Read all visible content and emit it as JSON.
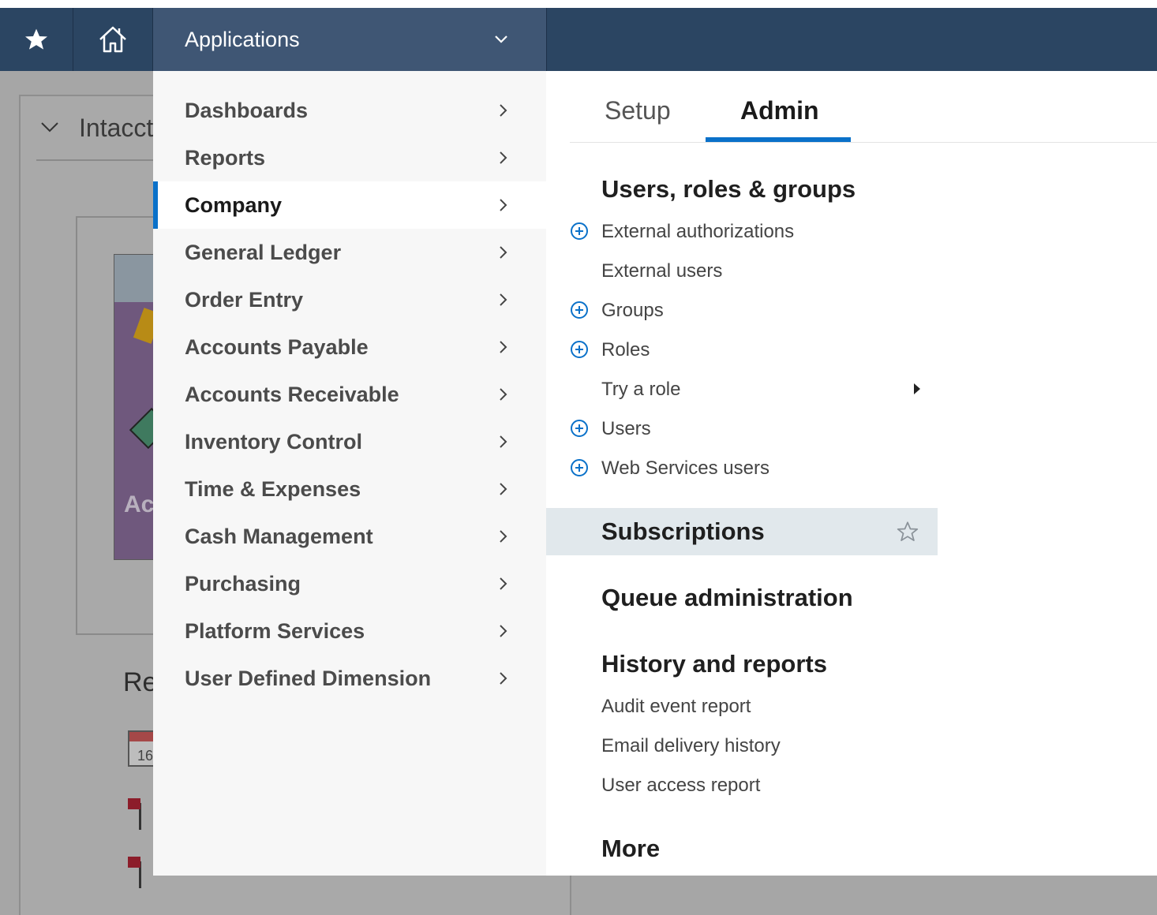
{
  "navbar": {
    "favorites_icon": "star-icon",
    "home_icon": "home-icon",
    "applications_label": "Applications"
  },
  "background_page": {
    "section_title": "Intacct",
    "tile_text": "Ac",
    "heading_partial": "Re",
    "calendar_day": "16"
  },
  "menu": {
    "items": [
      {
        "label": "Dashboards"
      },
      {
        "label": "Reports"
      },
      {
        "label": "Company"
      },
      {
        "label": "General Ledger"
      },
      {
        "label": "Order Entry"
      },
      {
        "label": "Accounts Payable"
      },
      {
        "label": "Accounts Receivable"
      },
      {
        "label": "Inventory Control"
      },
      {
        "label": "Time & Expenses"
      },
      {
        "label": "Cash Management"
      },
      {
        "label": "Purchasing"
      },
      {
        "label": "Platform Services"
      },
      {
        "label": "User Defined Dimension"
      }
    ],
    "active_item": "Company"
  },
  "submenu": {
    "tabs": [
      {
        "label": "Setup"
      },
      {
        "label": "Admin"
      }
    ],
    "active_tab": "Admin",
    "users_section": {
      "heading": "Users, roles & groups",
      "links": [
        {
          "label": "External authorizations",
          "add": true
        },
        {
          "label": "External users",
          "add": false
        },
        {
          "label": "Groups",
          "add": true
        },
        {
          "label": "Roles",
          "add": true
        },
        {
          "label": "Try a role",
          "add": false
        },
        {
          "label": "Users",
          "add": true
        },
        {
          "label": "Web Services users",
          "add": true
        }
      ]
    },
    "subscriptions": "Subscriptions",
    "queue_administration": "Queue administration",
    "history_section": {
      "heading": "History and reports",
      "links": [
        {
          "label": "Audit event report"
        },
        {
          "label": "Email delivery history"
        },
        {
          "label": "User access report"
        }
      ]
    },
    "more": "More"
  },
  "colors": {
    "navbar": "#2b4562",
    "navbar_active": "#3f5674",
    "accent": "#0a71c9",
    "menu_bg": "#f7f7f7",
    "highlight_row": "#e1e8ec"
  }
}
